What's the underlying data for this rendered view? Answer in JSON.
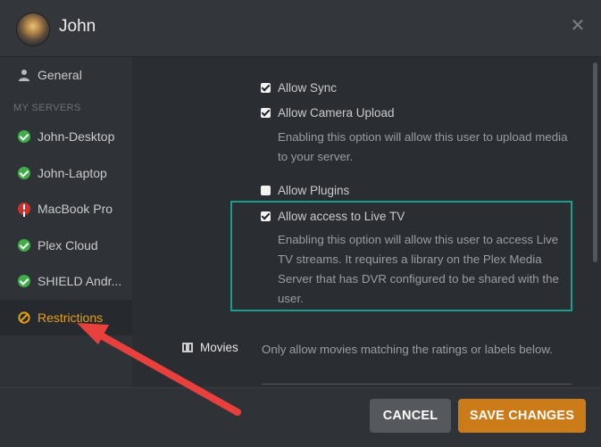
{
  "header": {
    "title": "John"
  },
  "sidebar": {
    "general_label": "General",
    "section_heading": "MY SERVERS",
    "servers": [
      {
        "label": "John-Desktop",
        "status": "ok"
      },
      {
        "label": "John-Laptop",
        "status": "ok"
      },
      {
        "label": "MacBook Pro",
        "status": "error"
      },
      {
        "label": "Plex Cloud",
        "status": "ok"
      },
      {
        "label": "SHIELD Andr...",
        "status": "ok"
      }
    ],
    "restrictions_label": "Restrictions"
  },
  "options": {
    "allow_sync": {
      "label": "Allow Sync",
      "checked": true
    },
    "allow_camera_upload": {
      "label": "Allow Camera Upload",
      "checked": true,
      "description": "Enabling this option will allow this user to upload media to your server."
    },
    "allow_plugins": {
      "label": "Allow Plugins",
      "checked": false
    },
    "allow_live_tv": {
      "label": "Allow access to Live TV",
      "checked": true,
      "description": "Enabling this option will allow this user to access Live TV streams. It requires a library on the Plex Media Server that has DVR configured to be shared with the user."
    }
  },
  "movies": {
    "label": "Movies",
    "description": "Only allow movies matching the ratings or labels below."
  },
  "footer": {
    "cancel_label": "CANCEL",
    "save_label": "SAVE CHANGES"
  },
  "colors": {
    "accent": "#e5a00d",
    "save_button": "#cc7b19",
    "highlight_box": "#1b9e8e",
    "annotation_arrow": "#e8403c"
  }
}
